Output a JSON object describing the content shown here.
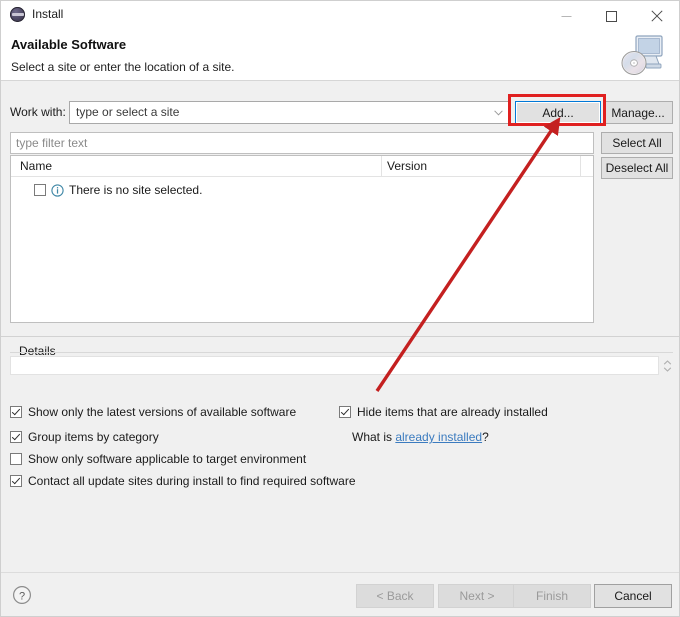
{
  "window": {
    "title": "Install",
    "icon": "eclipse-install-icon",
    "controls": {
      "minimize": "minimize-icon",
      "maximize": "maximize-icon",
      "close": "close-icon"
    }
  },
  "header": {
    "title": "Available Software",
    "subtitle": "Select a site or enter the location of a site.",
    "banner_icon": "computer-with-disc-icon"
  },
  "work_with": {
    "label": "Work with:",
    "placeholder": "type or select a site",
    "value": "",
    "add_button": "Add...",
    "manage_button": "Manage..."
  },
  "filter": {
    "placeholder": "type filter text",
    "value": ""
  },
  "list_actions": {
    "select_all": "Select All",
    "deselect_all": "Deselect All"
  },
  "table": {
    "columns": [
      "Name",
      "Version"
    ],
    "rows": [
      {
        "checked": false,
        "icon": "info-icon",
        "name": "There is no site selected.",
        "version": ""
      }
    ]
  },
  "details": {
    "legend": "Details",
    "value": ""
  },
  "options": {
    "left": [
      {
        "label": "Show only the latest versions of available software",
        "checked": true
      },
      {
        "label": "Group items by category",
        "checked": true
      },
      {
        "label": "Show only software applicable to target environment",
        "checked": false
      },
      {
        "label": "Contact all update sites during install to find required software",
        "checked": true
      }
    ],
    "right": [
      {
        "label": "Hide items that are already installed",
        "checked": true
      }
    ],
    "what_is_prefix": "What is ",
    "what_is_link": "already installed",
    "what_is_suffix": "?"
  },
  "footer": {
    "help": "help-icon",
    "back": "< Back",
    "next": "Next >",
    "finish": "Finish",
    "cancel": "Cancel"
  },
  "annotation": {
    "highlight_color": "#e02020",
    "arrow_color": "#c42020",
    "target": "Add..."
  }
}
